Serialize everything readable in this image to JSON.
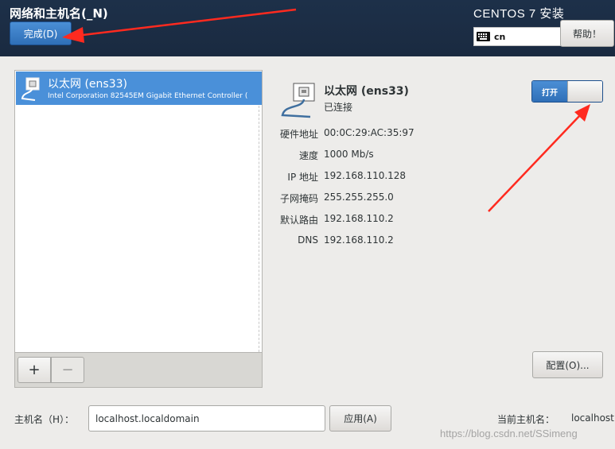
{
  "header": {
    "title": "网络和主机名(_N)",
    "done_label": "完成(D)",
    "product": "CENTOS 7 安装",
    "keyboard_layout": "cn",
    "help_label": "帮助！"
  },
  "device_list": {
    "items": [
      {
        "name": "以太网 (ens33)",
        "description": "Intel Corporation 82545EM Gigabit Ethernet Controller (",
        "selected": true
      }
    ],
    "add_label": "+",
    "remove_label": "−"
  },
  "details": {
    "name": "以太网 (ens33)",
    "status": "已连接",
    "switch_label": "打开",
    "switch_on": true,
    "properties": [
      {
        "label": "硬件地址",
        "value": "00:0C:29:AC:35:97"
      },
      {
        "label": "速度",
        "value": "1000 Mb/s"
      },
      {
        "label": "IP 地址",
        "value": "192.168.110.128"
      },
      {
        "label": "子网掩码",
        "value": "255.255.255.0"
      },
      {
        "label": "默认路由",
        "value": "192.168.110.2"
      },
      {
        "label": "DNS",
        "value": "192.168.110.2"
      }
    ],
    "configure_label": "配置(O)..."
  },
  "hostname": {
    "label": "主机名（H）：",
    "value": "localhost.localdomain",
    "apply_label": "应用(A)",
    "current_label": "当前主机名：",
    "current_value": "localhost"
  },
  "watermark": "https://blog.csdn.net/SSimeng",
  "colors": {
    "header_bg": "#1d3049",
    "accent": "#4a90d9",
    "annotation_arrow": "#ff2a1f"
  }
}
